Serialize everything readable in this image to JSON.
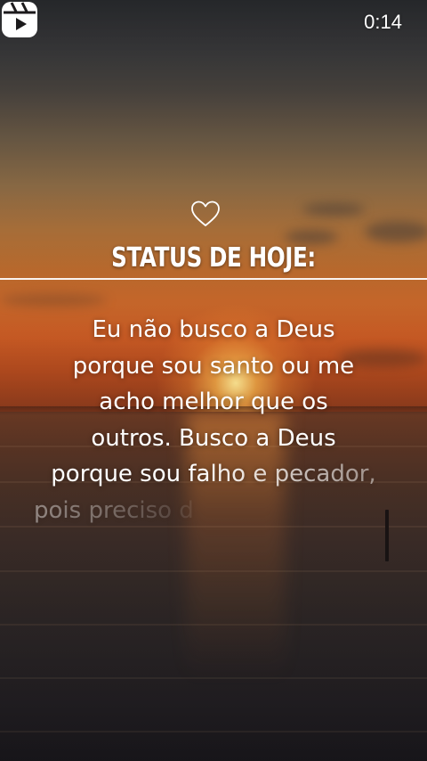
{
  "player": {
    "app_icon": "reels-icon",
    "elapsed_time": "0:14"
  },
  "overlay": {
    "heart_icon": "heart-outline-icon",
    "headline": "STATUS DE HOJE:",
    "quote_lines": [
      "Eu não busco a Deus",
      "porque sou santo ou me",
      "acho melhor que os",
      "outros. Busco a Deus",
      "porque sou falho e pecador,",
      "pois preciso d"
    ]
  },
  "colors": {
    "text": "#ffffff",
    "sunset_orange": "#c7662a",
    "sky_dark": "#2a2c30"
  }
}
